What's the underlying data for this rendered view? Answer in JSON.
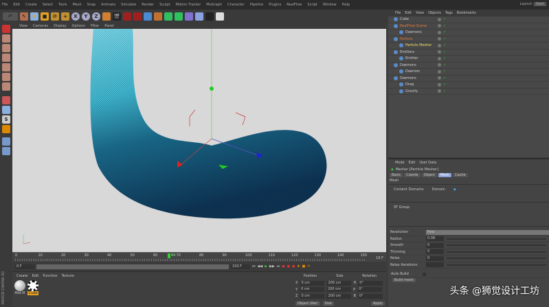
{
  "menu": [
    "File",
    "Edit",
    "Create",
    "Select",
    "Tools",
    "Mesh",
    "Snap",
    "Animate",
    "Simulate",
    "Render",
    "Sculpt",
    "Motion Tracker",
    "MoGraph",
    "Character",
    "Pipeline",
    "Plugins",
    "RealFlow",
    "Script",
    "Window",
    "Help"
  ],
  "layout": {
    "label": "Layout:",
    "value": "Start"
  },
  "toolbar": {
    "axes": [
      "X",
      "Y",
      "Z"
    ]
  },
  "viewport_menu": [
    "View",
    "Cameras",
    "Display",
    "Options",
    "Filter",
    "Panel"
  ],
  "object_manager": {
    "menu": [
      "File",
      "Edit",
      "View",
      "Objects",
      "Tags",
      "Bookmarks"
    ],
    "objects": [
      {
        "name": "Cube",
        "color": "#cfcfcf",
        "indent": 0
      },
      {
        "name": "RealFlow Scene",
        "color": "#e07a3a",
        "indent": 0
      },
      {
        "name": "Daemons",
        "color": "#cfcfcf",
        "indent": 1
      },
      {
        "name": "Particle",
        "color": "#e07a3a",
        "indent": 0
      },
      {
        "name": "Particle Mesher",
        "color": "#f0e060",
        "indent": 1
      },
      {
        "name": "Emitters",
        "color": "#cfcfcf",
        "indent": 0
      },
      {
        "name": "Emitter",
        "color": "#cfcfcf",
        "indent": 1
      },
      {
        "name": "Daemons",
        "color": "#cfcfcf",
        "indent": 0
      },
      {
        "name": "Daemon",
        "color": "#cfcfcf",
        "indent": 1
      },
      {
        "name": "Daemons",
        "color": "#cfcfcf",
        "indent": 0
      },
      {
        "name": "Drag",
        "color": "#cfcfcf",
        "indent": 1
      },
      {
        "name": "Gravity",
        "color": "#cfcfcf",
        "indent": 1
      }
    ]
  },
  "attributes": {
    "menu": [
      "Mode",
      "Edit",
      "User Data"
    ],
    "title": "Mesher [Particle Mesher]",
    "tabs": [
      "Basic",
      "Coords",
      "Object",
      "Mesh",
      "Cache"
    ],
    "active_tab": "Mesh",
    "section": "Mesh",
    "content_domains_label": "Content Domains",
    "content_domains_value": "Domain",
    "sf_group_label": "SF Group",
    "params": [
      {
        "label": "Resolution",
        "value": "Fine"
      },
      {
        "label": "Radius",
        "value": "0.08"
      },
      {
        "label": "Smooth",
        "value": "0"
      },
      {
        "label": "Thinning",
        "value": "0"
      },
      {
        "label": "Relax",
        "value": "0"
      },
      {
        "label": "Relax Iterations",
        "value": ""
      }
    ],
    "auto_build_label": "Auto Build",
    "build_button": "Build mesh"
  },
  "timeline": {
    "ticks": [
      "0",
      "10",
      "20",
      "30",
      "40",
      "50",
      "60",
      "70",
      "80",
      "90",
      "100",
      "110",
      "120",
      "130",
      "140",
      "150"
    ],
    "current_frame": "64",
    "end_label": "16 F"
  },
  "transport": {
    "start": "0 F",
    "end": "150 F"
  },
  "material_manager": {
    "menu": [
      "Create",
      "Edit",
      "Function",
      "Texture"
    ],
    "materials": [
      "Mat.M",
      "Cube"
    ]
  },
  "coordinates": {
    "headers": [
      "Position",
      "Size",
      "Rotation"
    ],
    "rows": [
      {
        "axis": "X",
        "pos": "0 cm",
        "size": "200 cm",
        "rotl": "H",
        "rot": "0°"
      },
      {
        "axis": "Y",
        "pos": "0 cm",
        "size": "200 cm",
        "rotl": "P",
        "rot": "0°"
      },
      {
        "axis": "Z",
        "pos": "0 cm",
        "size": "200 cm",
        "rotl": "B",
        "rot": "0°"
      }
    ],
    "mode": "Object (Rel)",
    "size_mode": "Size",
    "apply": "Apply"
  },
  "brand": "MAXON CINEMA 4D",
  "watermark": "头条 @狮觉设计工坊"
}
